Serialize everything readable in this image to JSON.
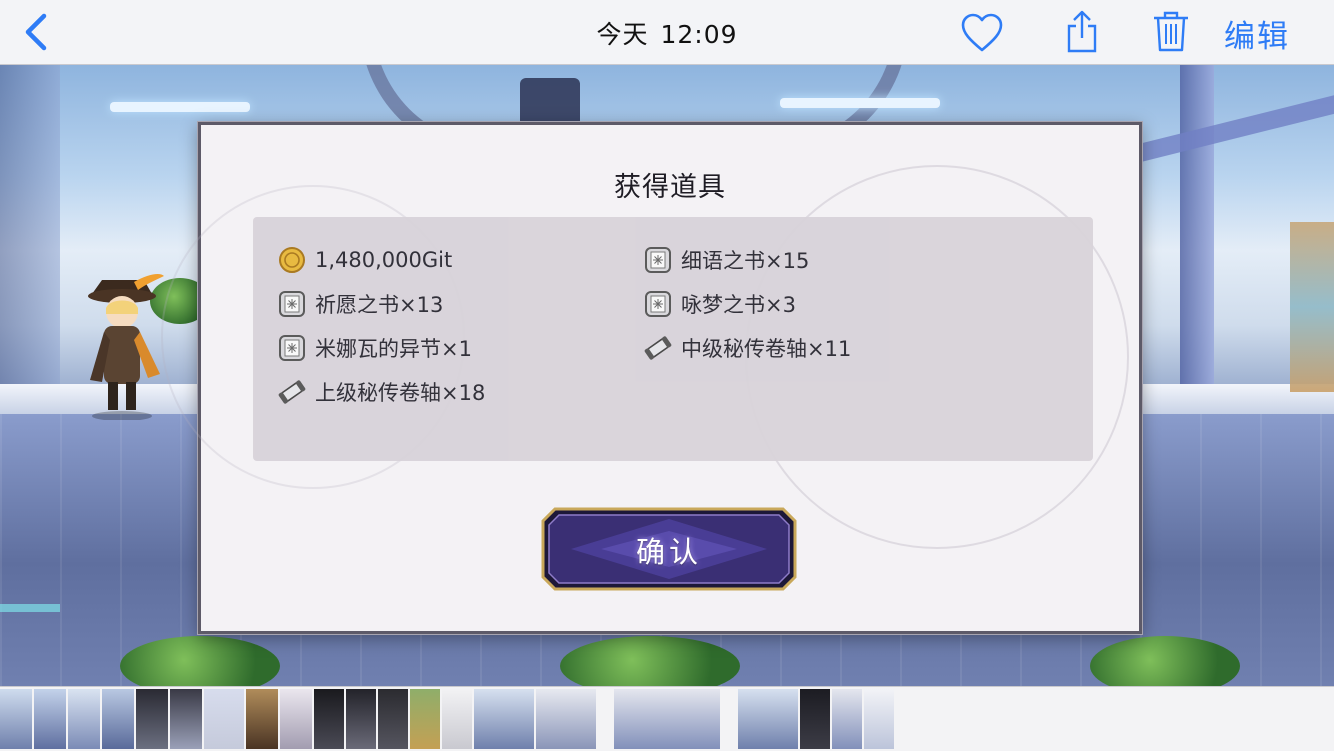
{
  "topbar": {
    "date": "今天",
    "time": "12:09",
    "edit_label": "编辑",
    "back_icon": "chevron-left-icon",
    "favorite_icon": "heart-icon",
    "share_icon": "share-icon",
    "delete_icon": "trash-icon",
    "accent_color": "#2e7cf6"
  },
  "dialog": {
    "title": "获得道具",
    "confirm_label": "确认",
    "items": [
      {
        "icon": "coin-icon",
        "label": "1,480,000Git"
      },
      {
        "icon": "book-icon",
        "label": "细语之书×15"
      },
      {
        "icon": "book-icon",
        "label": "祈愿之书×13"
      },
      {
        "icon": "book-icon",
        "label": "咏梦之书×3"
      },
      {
        "icon": "book-icon",
        "label": "米娜瓦的异节×1"
      },
      {
        "icon": "scroll-icon",
        "label": "中级秘传卷轴×11"
      },
      {
        "icon": "scroll-icon",
        "label": "上级秘传卷轴×18"
      }
    ]
  }
}
